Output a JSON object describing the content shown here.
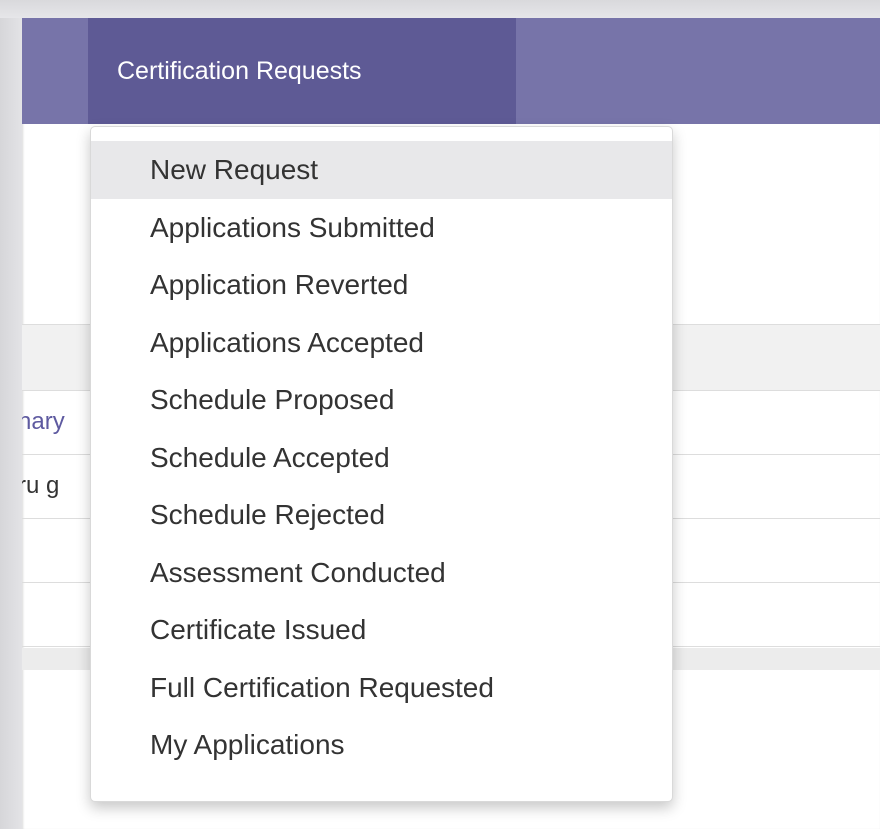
{
  "navbar": {
    "active_item_label": "Certification Requests",
    "colors": {
      "bar": "#7774a9",
      "active": "#5e5a95",
      "text": "#ffffff"
    }
  },
  "table": {
    "rows": [
      {
        "first_cell": "hary",
        "is_link": true
      },
      {
        "first_cell": "ru g",
        "is_link": false
      },
      {
        "first_cell": ""
      },
      {
        "first_cell": ""
      }
    ]
  },
  "dropdown": {
    "highlighted_index": 0,
    "items": [
      {
        "label": "New Request"
      },
      {
        "label": "Applications Submitted"
      },
      {
        "label": "Application Reverted"
      },
      {
        "label": "Applications Accepted"
      },
      {
        "label": "Schedule Proposed"
      },
      {
        "label": "Schedule Accepted"
      },
      {
        "label": "Schedule Rejected"
      },
      {
        "label": "Assessment Conducted"
      },
      {
        "label": "Certificate Issued"
      },
      {
        "label": "Full Certification Requested"
      },
      {
        "label": "My Applications"
      }
    ]
  }
}
